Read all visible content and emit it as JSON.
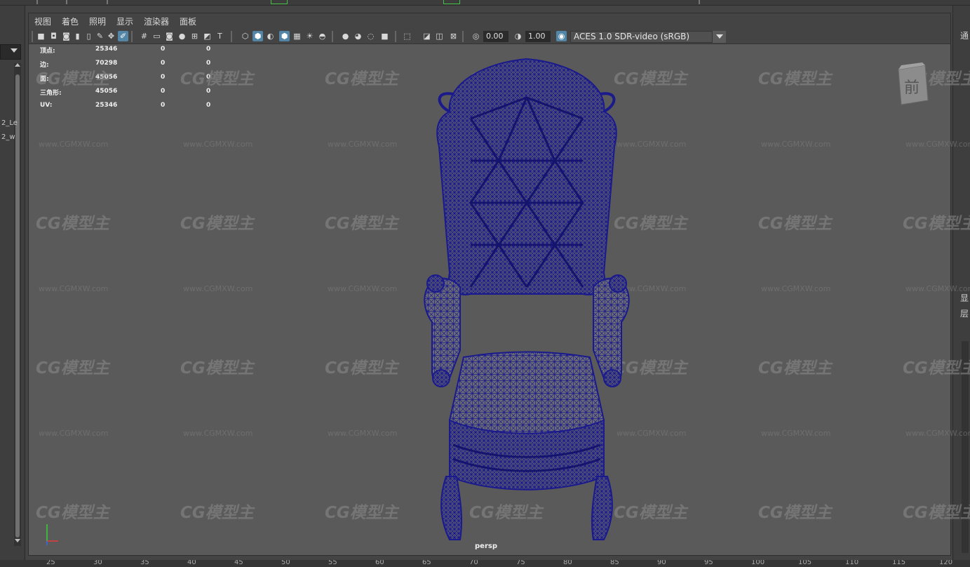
{
  "menu": {
    "items": [
      "视图",
      "着色",
      "照明",
      "显示",
      "渲染器",
      "面板"
    ]
  },
  "toolbar": {
    "exposure_value": "0.00",
    "gamma_value": "1.00",
    "color_space": "ACES 1.0 SDR-video (sRGB)"
  },
  "hud": {
    "rows": [
      {
        "label": "顶点:",
        "count": "25346",
        "sel1": "0",
        "sel2": "0"
      },
      {
        "label": "边:",
        "count": "70298",
        "sel1": "0",
        "sel2": "0"
      },
      {
        "label": "面:",
        "count": "45056",
        "sel1": "0",
        "sel2": "0"
      },
      {
        "label": "三角形:",
        "count": "45056",
        "sel1": "0",
        "sel2": "0"
      },
      {
        "label": "UV:",
        "count": "25346",
        "sel1": "0",
        "sel2": "0"
      }
    ]
  },
  "outliner": {
    "item1": "2_Le",
    "item2": "2_w"
  },
  "right_panel": {
    "char_top": "通",
    "char_mid1": "显",
    "char_mid2": "层"
  },
  "viewcube": {
    "face": "前"
  },
  "viewport": {
    "camera": "persp",
    "watermark_logo": "CG模型主",
    "watermark_url": "www.CGMXW.com",
    "wireframe_color": "#1a1a8c"
  },
  "timeline": {
    "ticks": [
      "25",
      "30",
      "35",
      "40",
      "45",
      "50",
      "55",
      "60",
      "65",
      "70",
      "75",
      "80",
      "85",
      "90",
      "95",
      "100",
      "105",
      "110",
      "115",
      "120"
    ]
  },
  "colors": {
    "panel_bg": "#5a5a5a",
    "ui_bg": "#444444",
    "active_icon": "#5285a6",
    "wireframe": "#1a1a8c"
  }
}
